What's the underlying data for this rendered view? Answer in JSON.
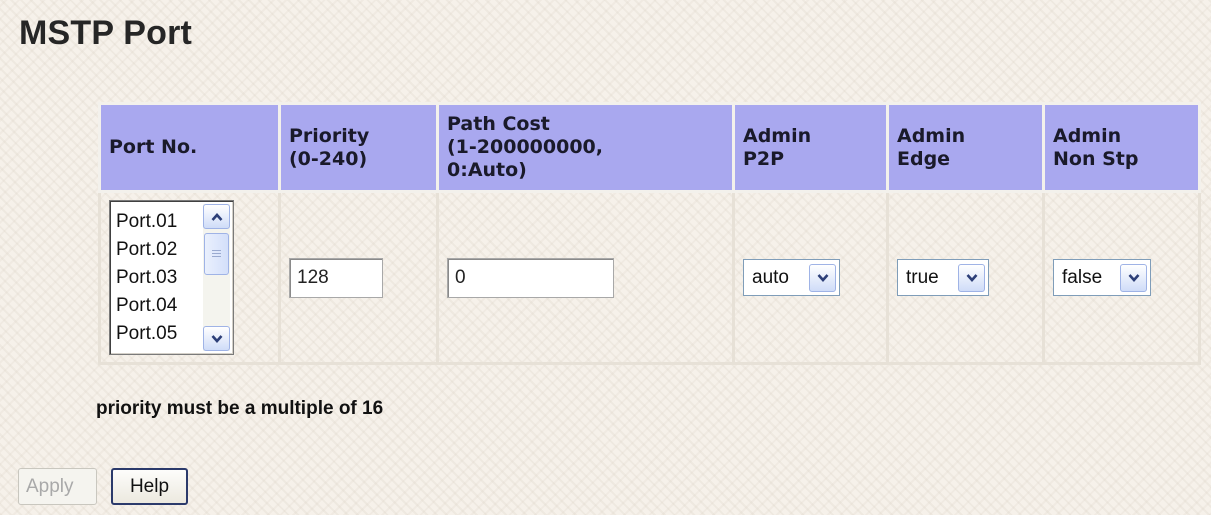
{
  "page": {
    "title": "MSTP Port"
  },
  "table": {
    "headers": {
      "port_no": "Port No.",
      "priority": [
        "Priority",
        "(0-240)"
      ],
      "path_cost": [
        "Path Cost",
        "(1-200000000,",
        "0:Auto)"
      ],
      "admin_p2p": [
        "Admin",
        "P2P"
      ],
      "admin_edge": [
        "Admin",
        "Edge"
      ],
      "admin_non_stp": [
        "Admin",
        "Non Stp"
      ]
    },
    "port_list": [
      "Port.01",
      "Port.02",
      "Port.03",
      "Port.04",
      "Port.05"
    ],
    "priority_value": "128",
    "path_cost_value": "0",
    "admin_p2p_value": "auto",
    "admin_edge_value": "true",
    "admin_non_stp_value": "false"
  },
  "note": "priority must be a multiple of 16",
  "buttons": {
    "apply": "Apply",
    "help": "Help"
  },
  "icons": {
    "scroll_up": "chevron-up-icon",
    "scroll_down": "chevron-down-icon",
    "dropdown": "chevron-down-icon"
  },
  "colors": {
    "header_bg": "#a9a8ef",
    "scroll_button": "#cfdcf8",
    "accent_border": "#2b3a6b"
  }
}
